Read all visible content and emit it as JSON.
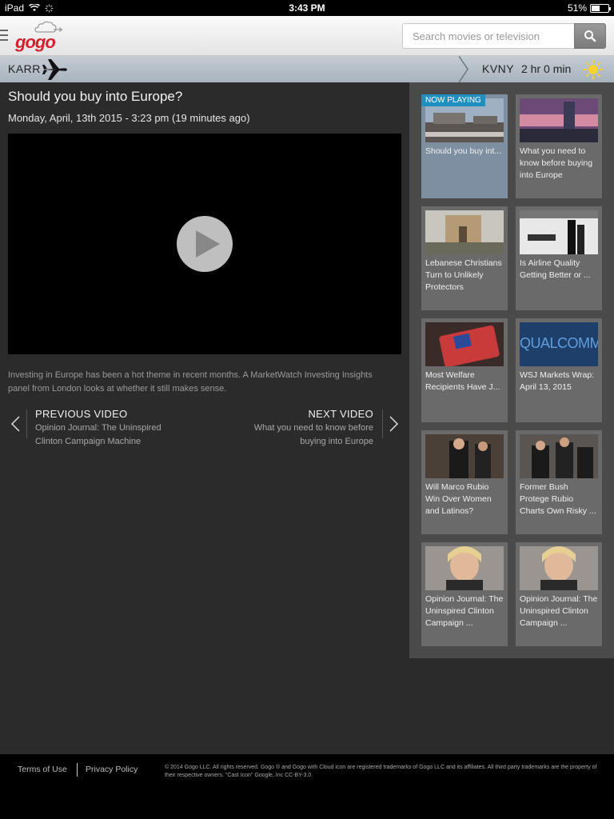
{
  "status_bar": {
    "device": "iPad",
    "time": "3:43 PM",
    "battery": "51%"
  },
  "header": {
    "logo_text": "gogo",
    "search_placeholder": "Search movies or television"
  },
  "flight": {
    "origin": "KARR",
    "destination": "KVNY",
    "eta": "2 hr 0 min"
  },
  "video": {
    "title": "Should you buy into Europe?",
    "date": "Monday, April, 13th 2015 - 3:23 pm (19 minutes ago)",
    "description": "Investing in Europe has been a hot theme in recent months. A MarketWatch Investing Insights panel from London looks at whether it still makes sense."
  },
  "nav": {
    "prev_label": "PREVIOUS VIDEO",
    "prev_title": "Opinion Journal: The Uninspired Clinton Campaign Machine",
    "next_label": "NEXT VIDEO",
    "next_title": "What you need to know before buying into Europe"
  },
  "playlist": {
    "now_playing_label": "NOW PLAYING",
    "items": [
      {
        "caption": "Should you buy int...",
        "active": true
      },
      {
        "caption": "What you need to know before buying into Europe",
        "active": false
      },
      {
        "caption": "Lebanese Christians Turn to Unlikely Protectors",
        "active": false
      },
      {
        "caption": "Is Airline Quality Getting Better or ...",
        "active": false
      },
      {
        "caption": "Most Welfare Recipients Have J...",
        "active": false
      },
      {
        "caption": "WSJ Markets Wrap: April 13, 2015",
        "active": false,
        "thumb_text": "QUALCOMM"
      },
      {
        "caption": "Will Marco Rubio Win Over Women and Latinos?",
        "active": false
      },
      {
        "caption": "Former Bush Protege Rubio Charts Own Risky ...",
        "active": false
      },
      {
        "caption": "Opinion Journal: The Uninspired Clinton Campaign ...",
        "active": false
      },
      {
        "caption": "Opinion Journal: The Uninspired Clinton Campaign ...",
        "active": false
      }
    ]
  },
  "footer": {
    "terms": "Terms of Use",
    "privacy": "Privacy Policy",
    "copyright": "© 2014 Gogo LLC. All rights reserved. Gogo ® and Gogo with Cloud icon are registered trademarks of Gogo LLC and its affiliates. All third party trademarks are the property of their respective owners. \"Cast Icon\" Google, Inc CC-BY-3.0"
  },
  "colors": {
    "brand_red": "#d61f2c",
    "now_playing_blue": "#1f8fc0",
    "main_bg": "#2b2b2b"
  }
}
